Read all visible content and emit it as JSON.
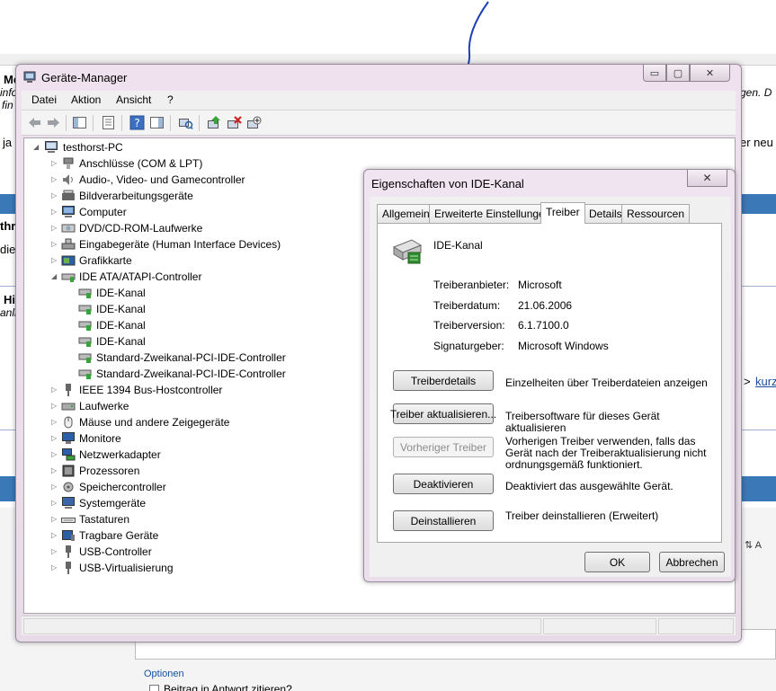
{
  "background": {
    "fragments": {
      "me": "Me",
      "inf": "info",
      "fir": "fin",
      "ja": "ja",
      "thr": "thr",
      "die": "die",
      "hi": "Hi",
      "anli": "anli",
      "right_gen": "gen. D",
      "right_neu": "er neu",
      "arrow": ">",
      "link": "kurz",
      "optionen": "Optionen",
      "beitrag": "Beitrag in Antwort zitieren?"
    }
  },
  "devmgr": {
    "title": "Geräte-Manager",
    "menu": [
      "Datei",
      "Aktion",
      "Ansicht",
      "?"
    ],
    "tree": {
      "root": "testhorst-PC",
      "items": [
        "Anschlüsse (COM & LPT)",
        "Audio-, Video- und Gamecontroller",
        "Bildverarbeitungsgeräte",
        "Computer",
        "DVD/CD-ROM-Laufwerke",
        "Eingabegeräte (Human Interface Devices)",
        "Grafikkarte",
        "IDE ATA/ATAPI-Controller",
        "IEEE 1394 Bus-Hostcontroller",
        "Laufwerke",
        "Mäuse und andere Zeigegeräte",
        "Monitore",
        "Netzwerkadapter",
        "Prozessoren",
        "Speichercontroller",
        "Systemgeräte",
        "Tastaturen",
        "Tragbare Geräte",
        "USB-Controller",
        "USB-Virtualisierung"
      ],
      "ide_children": [
        "IDE-Kanal",
        "IDE-Kanal",
        "IDE-Kanal",
        "IDE-Kanal",
        "Standard-Zweikanal-PCI-IDE-Controller",
        "Standard-Zweikanal-PCI-IDE-Controller"
      ]
    }
  },
  "props": {
    "title": "Eigenschaften von IDE-Kanal",
    "close": "✕",
    "tabs": [
      "Allgemein",
      "Erweiterte Einstellungen",
      "Treiber",
      "Details",
      "Ressourcen"
    ],
    "active_tab": "Treiber",
    "device_name": "IDE-Kanal",
    "info": [
      {
        "label": "Treiberanbieter:",
        "value": "Microsoft"
      },
      {
        "label": "Treiberdatum:",
        "value": "21.06.2006"
      },
      {
        "label": "Treiberversion:",
        "value": "6.1.7100.0"
      },
      {
        "label": "Signaturgeber:",
        "value": "Microsoft Windows"
      }
    ],
    "actions": [
      {
        "button": "Treiberdetails",
        "desc": "Einzelheiten über Treiberdateien anzeigen",
        "enabled": true
      },
      {
        "button": "Treiber aktualisieren...",
        "desc": "Treibersoftware für dieses Gerät aktualisieren",
        "enabled": true
      },
      {
        "button": "Vorheriger Treiber",
        "desc": "Vorherigen Treiber verwenden, falls das Gerät nach der Treiberaktualisierung nicht ordnungsgemäß funktioniert.",
        "enabled": false
      },
      {
        "button": "Deaktivieren",
        "desc": "Deaktiviert das ausgewählte Gerät.",
        "enabled": true
      },
      {
        "button": "Deinstallieren",
        "desc": "Treiber deinstallieren (Erweitert)",
        "enabled": true
      }
    ],
    "ok": "OK",
    "cancel": "Abbrechen"
  },
  "colors": {
    "pen_stroke": "#1f3fb4",
    "band_blue": "#3a78b8",
    "window_frame": "#efe2ee"
  }
}
